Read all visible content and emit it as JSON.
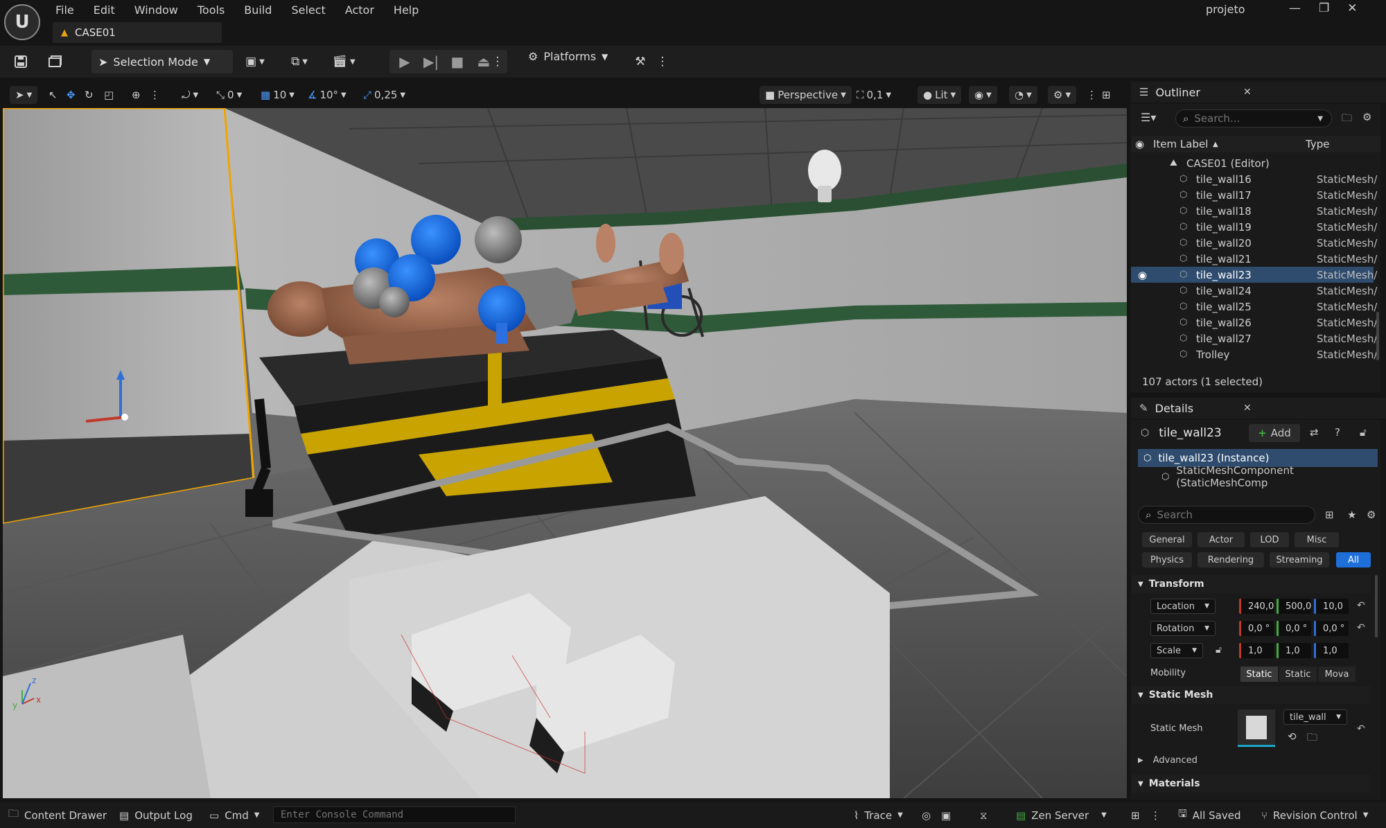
{
  "menu": [
    "File",
    "Edit",
    "Window",
    "Tools",
    "Build",
    "Select",
    "Actor",
    "Help"
  ],
  "level_tab": "CASE01",
  "project": "projeto",
  "toolbar": {
    "selection_mode": "Selection Mode",
    "platforms": "Platforms"
  },
  "viewport_toolbar": {
    "rot_snap_val": "0",
    "grid_snap": "10",
    "angle_snap": "10°",
    "scale_snap": "0,25",
    "perspective": "Perspective",
    "camera_speed": "0,1",
    "lit": "Lit"
  },
  "outliner": {
    "title": "Outliner",
    "search_placeholder": "Search...",
    "col_label": "Item Label",
    "col_type": "Type",
    "root": "CASE01 (Editor)",
    "items": [
      {
        "label": "tile_wall16",
        "type": "StaticMesh/"
      },
      {
        "label": "tile_wall17",
        "type": "StaticMesh/"
      },
      {
        "label": "tile_wall18",
        "type": "StaticMesh/"
      },
      {
        "label": "tile_wall19",
        "type": "StaticMesh/"
      },
      {
        "label": "tile_wall20",
        "type": "StaticMesh/"
      },
      {
        "label": "tile_wall21",
        "type": "StaticMesh/"
      },
      {
        "label": "tile_wall23",
        "type": "StaticMesh/"
      },
      {
        "label": "tile_wall24",
        "type": "StaticMesh/"
      },
      {
        "label": "tile_wall25",
        "type": "StaticMesh/"
      },
      {
        "label": "tile_wall26",
        "type": "StaticMesh/"
      },
      {
        "label": "tile_wall27",
        "type": "StaticMesh/"
      },
      {
        "label": "Trolley",
        "type": "StaticMesh/"
      }
    ],
    "footer": "107 actors (1 selected)"
  },
  "details": {
    "title": "Details",
    "actor": "tile_wall23",
    "add": "Add",
    "instance": "tile_wall23 (Instance)",
    "component": "StaticMeshComponent (StaticMeshComp",
    "search_placeholder": "Search",
    "filters": [
      "General",
      "Actor",
      "LOD",
      "Misc",
      "Physics",
      "Rendering",
      "Streaming",
      "All"
    ],
    "transform": "Transform",
    "location": {
      "label": "Location",
      "x": "240,0",
      "y": "500,0",
      "z": "10,0"
    },
    "rotation": {
      "label": "Rotation",
      "x": "0,0 °",
      "y": "0,0 °",
      "z": "0,0 °"
    },
    "scale": {
      "label": "Scale",
      "x": "1,0",
      "y": "1,0",
      "z": "1,0"
    },
    "mobility": {
      "label": "Mobility",
      "options": [
        "Static",
        "Static",
        "Mova"
      ]
    },
    "static_mesh_section": "Static Mesh",
    "static_mesh_label": "Static Mesh",
    "static_mesh_value": "tile_wall",
    "advanced": "Advanced",
    "materials": "Materials"
  },
  "statusbar": {
    "content_drawer": "Content Drawer",
    "output_log": "Output Log",
    "cmd": "Cmd",
    "console_placeholder": "Enter Console Command",
    "trace": "Trace",
    "zen_server": "Zen Server",
    "all_saved": "All Saved",
    "revision_control": "Revision Control"
  },
  "colors": {
    "accent": "#1e6fd9",
    "selected_row": "#2f4c6e",
    "warning": "#e8a317"
  }
}
